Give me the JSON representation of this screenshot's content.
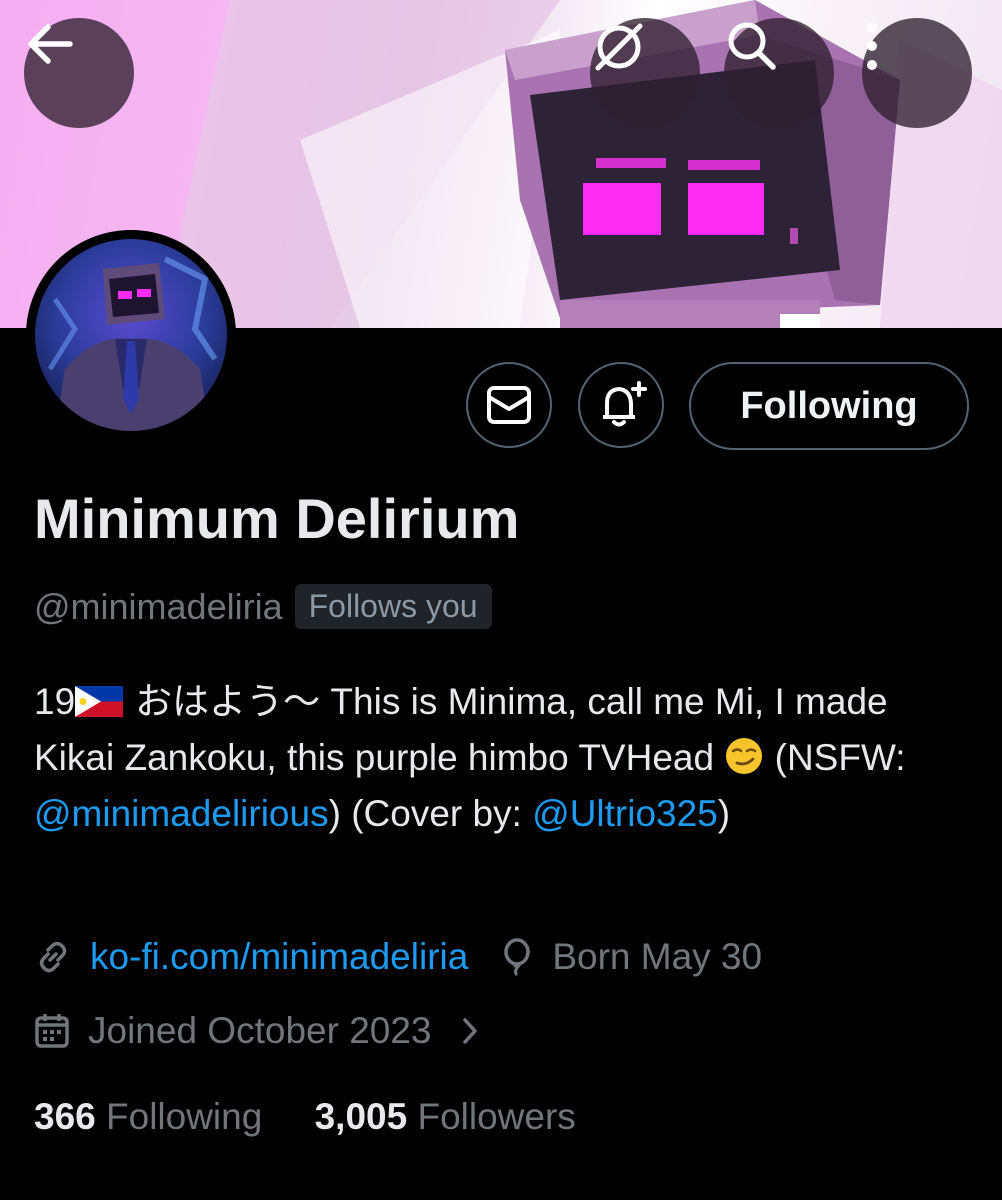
{
  "header": {
    "back_icon": "arrow-left-icon",
    "grok_icon": "grok-slash-icon",
    "search_icon": "search-icon",
    "more_icon": "more-vertical-icon"
  },
  "profile": {
    "display_name": "Minimum Delirium",
    "handle": "@minimadeliria",
    "follows_you": "Follows you",
    "following_button": "Following",
    "bio": {
      "line_start": "おはよう〜 This is Minima, call me Mi, I made Kikai Zankoku, this purple himbo TVHead",
      "age": "19",
      "nsfw_prefix": "(NSFW: ",
      "nsfw_link": "@minimadelirious",
      "nsfw_suffix": ")",
      "cover_prefix": " (Cover by: ",
      "cover_link": "@Ultrio325",
      "cover_suffix": ")"
    },
    "website": "ko-fi.com/minimadeliria",
    "birthday": "Born May 30",
    "joined": "Joined October 2023",
    "following_count": "366",
    "following_label": "Following",
    "followers_count": "3,005",
    "followers_label": "Followers"
  },
  "colors": {
    "link": "#1d9bf0",
    "muted": "#71767b",
    "text": "#e7e9ea",
    "background": "#000000"
  }
}
